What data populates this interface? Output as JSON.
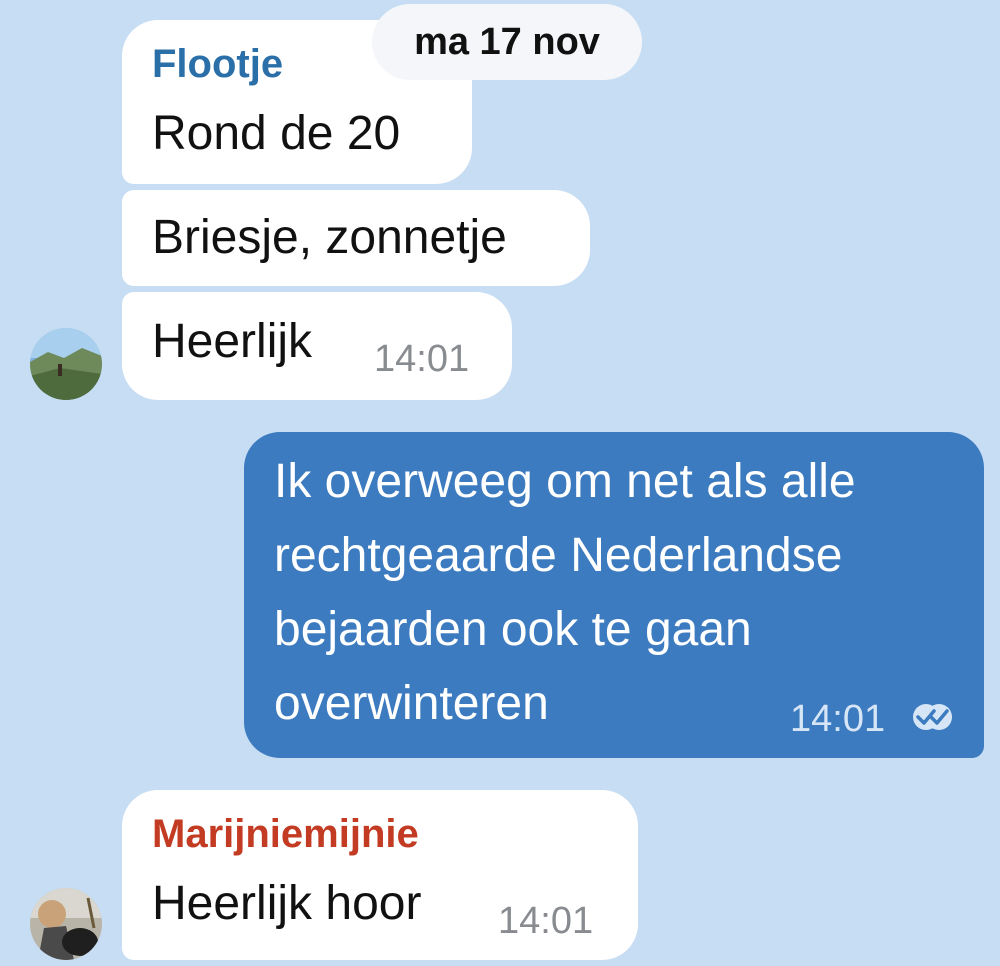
{
  "date_label": "ma 17 nov",
  "messages": [
    {
      "sender": "Flootje",
      "sender_color": "#2b6fa8",
      "texts": [
        "Rond de 20",
        "Briesje, zonnetje",
        "Heerlijk"
      ],
      "time": "14:01"
    },
    {
      "outgoing": true,
      "lines": [
        "Ik overweeg om net als alle",
        "rechtgeaarde Nederlandse",
        "bejaarden ook te gaan",
        "overwinteren"
      ],
      "time": "14:01",
      "status_icon": "double-check-icon"
    },
    {
      "sender": "Marijniemijnie",
      "sender_color": "#c23b22",
      "texts": [
        "Heerlijk hoor"
      ],
      "time": "14:01"
    }
  ],
  "colors": {
    "background": "#c7ddf3",
    "incoming_bubble": "#ffffff",
    "outgoing_bubble": "#3c7bbf"
  }
}
